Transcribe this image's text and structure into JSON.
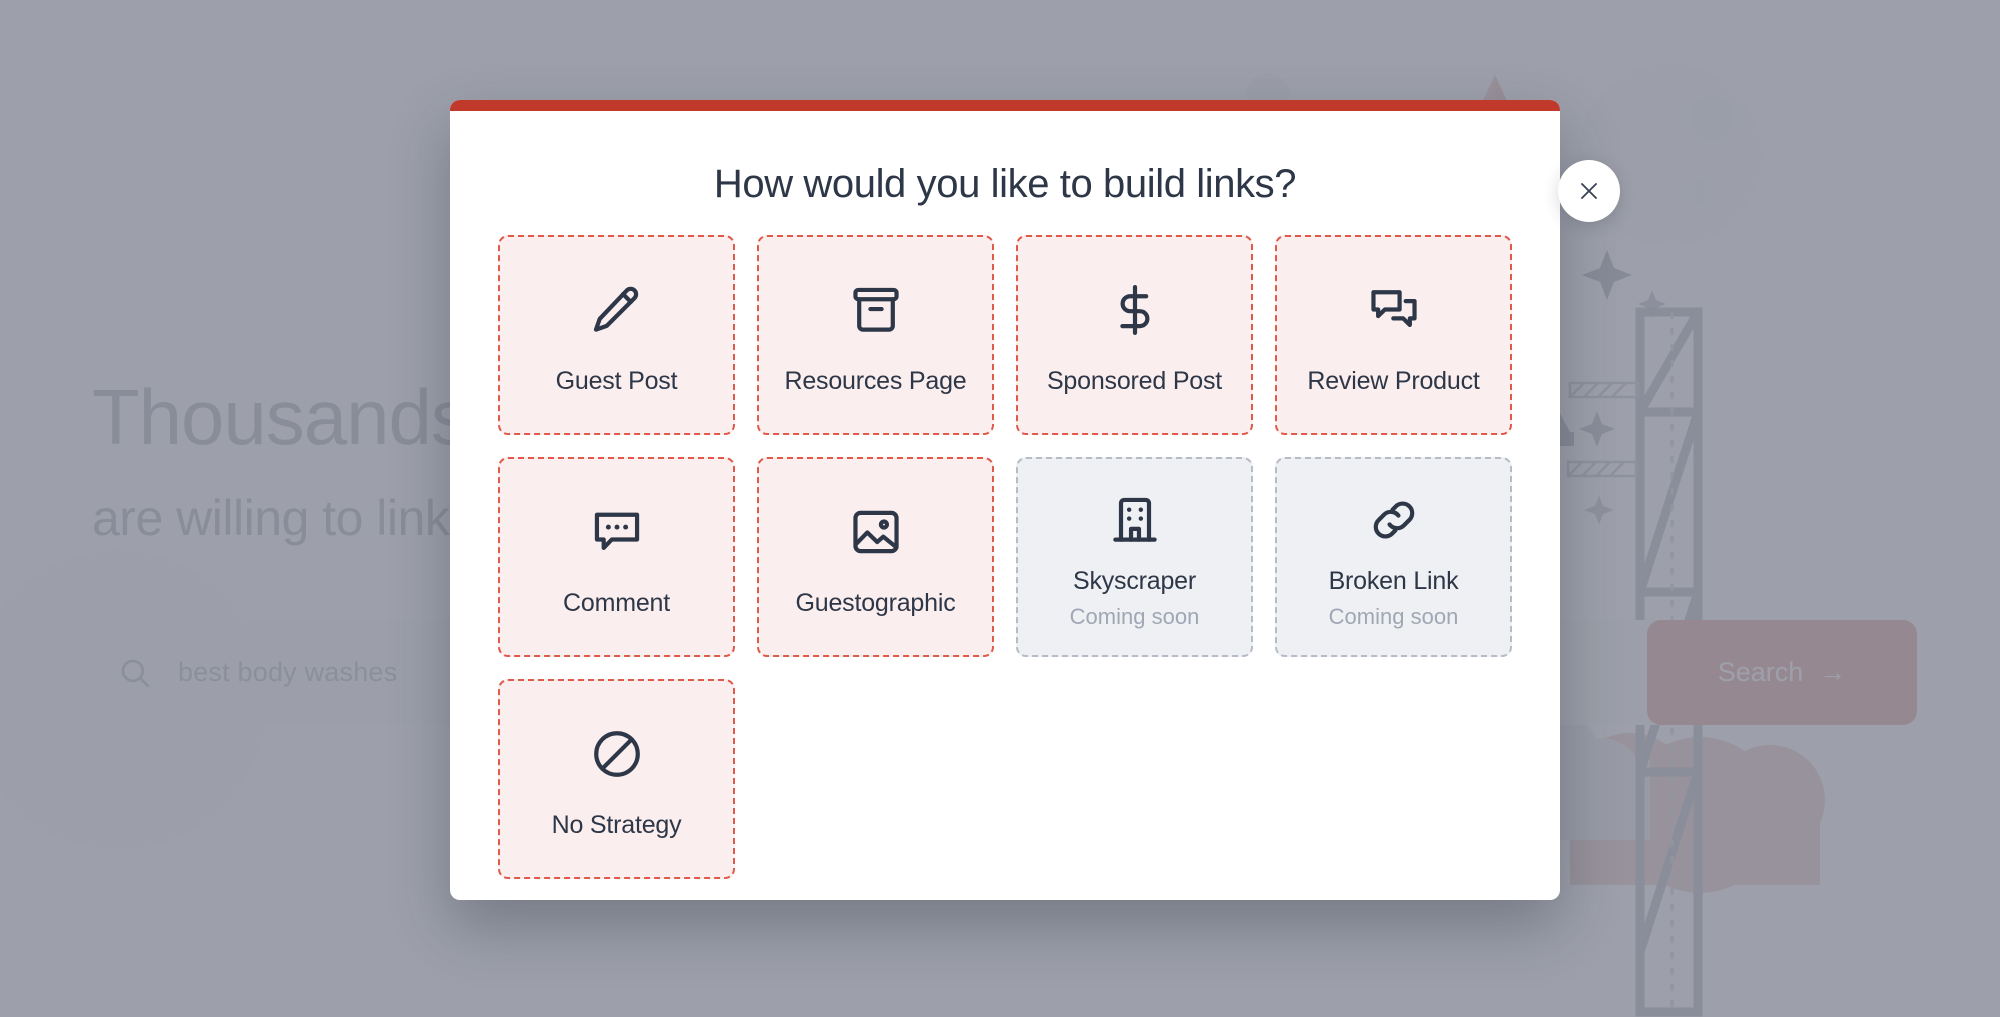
{
  "background": {
    "heading": "Thousands of site owners",
    "subheading": "are willing to link to you",
    "search": {
      "value": "best body washes",
      "icon": "search-icon",
      "help_icon": "?",
      "button_label": "Search",
      "button_arrow": "→",
      "button_color": "#c0392b"
    }
  },
  "modal": {
    "title": "How would you like to build links?",
    "accent_color": "#c0392b",
    "close_icon": "close-icon",
    "tile_fill": "#faeeee",
    "tile_border": "#e05a4a",
    "disabled_fill": "#eef0f3",
    "disabled_border": "#b6bcc6",
    "tiles": [
      {
        "label": "Guest Post",
        "icon": "pencil-icon",
        "sub": "",
        "disabled": false
      },
      {
        "label": "Resources Page",
        "icon": "archive-box-icon",
        "sub": "",
        "disabled": false
      },
      {
        "label": "Sponsored Post",
        "icon": "dollar-sign-icon",
        "sub": "",
        "disabled": false
      },
      {
        "label": "Review Product",
        "icon": "chat-bubbles-icon",
        "sub": "",
        "disabled": false
      },
      {
        "label": "Comment",
        "icon": "comment-dots-icon",
        "sub": "",
        "disabled": false
      },
      {
        "label": "Guestographic",
        "icon": "image-icon",
        "sub": "",
        "disabled": false
      },
      {
        "label": "Skyscraper",
        "icon": "building-icon",
        "sub": "Coming soon",
        "disabled": true
      },
      {
        "label": "Broken Link",
        "icon": "chain-link-icon",
        "sub": "Coming soon",
        "disabled": true
      },
      {
        "label": "No Strategy",
        "icon": "prohibited-icon",
        "sub": "",
        "disabled": false
      }
    ]
  }
}
